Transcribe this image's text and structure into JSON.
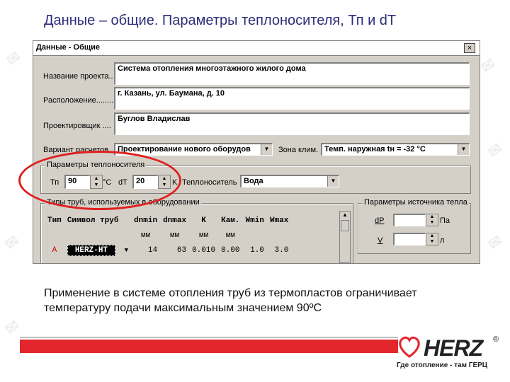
{
  "slide": {
    "title": "Данные – общие. Параметры теплоносителя, Тп и dT",
    "caption_line1": "Применение в системе отопления труб из термопластов ограничивает",
    "caption_line2": "температуру подачи максимальным значением 90ºC"
  },
  "dialog": {
    "title": "Данные - Общие",
    "close_label": "×",
    "project_name_label": "Название проекта..",
    "project_name_value": "Система отопления многоэтажного жилого дома",
    "location_label": "Расположение........",
    "location_value": "г. Казань, ул. Баумана, д. 10",
    "designer_label": "Проектировщик ....",
    "designer_value": "Буглов Владислав",
    "calc_variant_label": "Вариант расчетов",
    "calc_variant_value": "Проектирование нового оборудов",
    "climate_zone_label": "Зона клим.",
    "climate_zone_value": "Темп. наружная tн = -32 °C",
    "coolant_group_title": "Параметры теплоносителя",
    "tp_label": "Тп",
    "tp_value": "90",
    "tp_unit": "°C",
    "dt_label": "dТ",
    "dt_value": "20",
    "dt_unit": "K",
    "coolant_label": "Теплоноситель",
    "coolant_value": "Вода",
    "pipes_group_title": "Типы труб, используемых в оборудовании",
    "pipes_columns": [
      "Тип",
      "Символ труб",
      "dnmin",
      "dnmax",
      "K",
      "Кам.",
      "Wmin",
      "Wmax"
    ],
    "pipes_units": [
      "",
      "",
      "мм",
      "мм",
      "мм",
      "мм",
      "",
      ""
    ],
    "pipes_rows": [
      {
        "type": "A",
        "symbol": "HERZ-HT",
        "dnmin": "14",
        "dnmax": "63",
        "k": "0.010",
        "kam": "0.00",
        "wmin": "1.0",
        "wmax": "3.0"
      }
    ],
    "source_group_title": "Параметры источника тепла",
    "dp_label": "dP",
    "dp_unit": "Па",
    "v_label": "V",
    "v_unit": "л"
  },
  "logo": {
    "brand": "HERZ",
    "registered": "®",
    "tagline": "Где отопление - там ГЕРЦ"
  },
  "colors": {
    "title_blue": "#2e2e7a",
    "accent_red": "#e3262c",
    "dialog_gray": "#d4d0c8",
    "type_a_red": "#cc0000"
  },
  "icons": [
    "close-icon",
    "dropdown-arrow-icon",
    "spin-arrows-icon",
    "scrollbar-arrow-icon",
    "heart-logo-icon"
  ]
}
